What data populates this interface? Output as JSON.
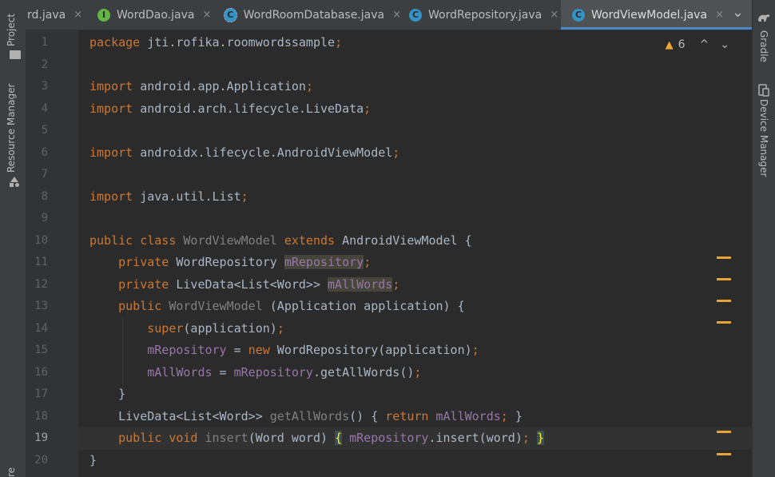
{
  "tabs": [
    {
      "label": "rd.java",
      "icon": "",
      "icon_letter": "",
      "active": false
    },
    {
      "label": "WordDao.java",
      "icon": "interface-icon",
      "icon_letter": "I",
      "active": false
    },
    {
      "label": "WordRoomDatabase.java",
      "icon": "abstract-class-icon",
      "icon_letter": "C",
      "active": false
    },
    {
      "label": "WordRepository.java",
      "icon": "class-icon",
      "icon_letter": "C",
      "active": false
    },
    {
      "label": "WordViewModel.java",
      "icon": "class-icon",
      "icon_letter": "C",
      "active": true
    }
  ],
  "tab_close_glyph": "×",
  "tab_overflow_glyph": "⌄",
  "left_panel": {
    "project_label": "Project",
    "resource_manager_label": "Resource Manager",
    "bottom_label": "re"
  },
  "right_panel": {
    "gradle_label": "Gradle",
    "device_manager_label": "Device Manager"
  },
  "warnings": {
    "count": "6",
    "up_glyph": "^",
    "down_glyph": "⌄"
  },
  "line_numbers": [
    "1",
    "2",
    "3",
    "4",
    "5",
    "6",
    "7",
    "8",
    "9",
    "10",
    "11",
    "12",
    "13",
    "14",
    "15",
    "16",
    "17",
    "18",
    "19",
    "20"
  ],
  "current_line": "19",
  "code": {
    "l1": {
      "kw": "package",
      "rest": " jti.rofika.roomwordssample",
      "semi": ";"
    },
    "l3": {
      "kw": "import",
      "rest": " android.app.Application",
      "semi": ";"
    },
    "l4": {
      "kw": "import",
      "rest": " android.arch.lifecycle.LiveData",
      "semi": ";"
    },
    "l6": {
      "kw": "import",
      "rest": " androidx.lifecycle.AndroidViewModel",
      "semi": ";"
    },
    "l8": {
      "kw": "import",
      "rest": " java.util.List",
      "semi": ";"
    },
    "l10": {
      "kw1": "public class ",
      "name": "WordViewModel",
      "kw2": " extends",
      "rest": " AndroidViewModel {"
    },
    "l11": {
      "indent": "    ",
      "kw": "private",
      "type": " WordRepository ",
      "field": "mRepository",
      "semi": ";"
    },
    "l12": {
      "indent": "    ",
      "kw": "private",
      "type": " LiveData<List<Word>> ",
      "field": "mAllWords",
      "semi": ";"
    },
    "l13": {
      "indent": "    ",
      "kw": "public",
      "name": " WordViewModel",
      "rest": " (Application application) {"
    },
    "l14": {
      "indent": "        ",
      "kw": "super",
      "rest": "(application)",
      "semi": ";"
    },
    "l15": {
      "indent": "        ",
      "field": "mRepository",
      "op": " = ",
      "kw": "new",
      "rest": " WordRepository(application)",
      "semi": ";"
    },
    "l16": {
      "indent": "        ",
      "field1": "mAllWords",
      "op": " = ",
      "field2": "mRepository",
      "rest": ".getAllWords()",
      "semi": ";"
    },
    "l17": {
      "indent": "    ",
      "rest": "}"
    },
    "l18": {
      "indent": "    ",
      "type": "LiveData<List<Word>> ",
      "name": "getAllWords",
      "rest": "() { ",
      "kw": "return",
      "sp": " ",
      "field": "mAllWords",
      "semi": ";",
      "close": " }"
    },
    "l19": {
      "indent": "    ",
      "kw1": "public void",
      "sp": " ",
      "name": "insert",
      "rest": "(Word word) ",
      "open": "{",
      "sp2": " ",
      "field": "mRepository",
      "call": ".insert(word)",
      "semi": ";",
      "sp3": " ",
      "close": "}"
    },
    "l20": {
      "rest": "}"
    }
  }
}
